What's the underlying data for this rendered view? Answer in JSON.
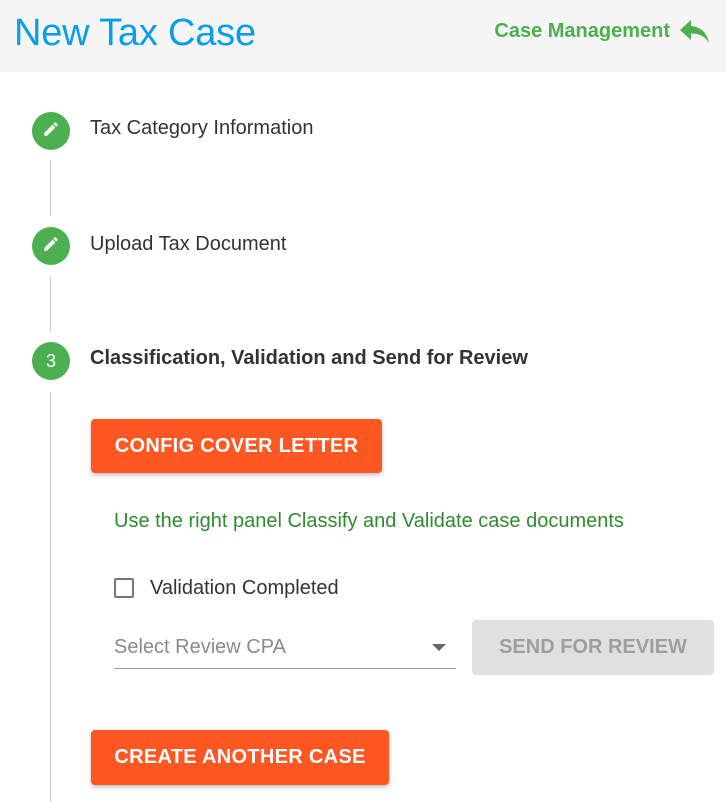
{
  "header": {
    "title": "New Tax Case",
    "nav_link_label": "Case Management",
    "nav_icon": "reply-icon"
  },
  "colors": {
    "title": "#0a9de8",
    "accent_green": "#4caf50",
    "button_orange": "#ff5722",
    "hint_green": "#2e8b2e",
    "disabled_bg": "#e0e0e0"
  },
  "steps": [
    {
      "indicator": "edit-icon",
      "title": "Tax Category Information"
    },
    {
      "indicator": "edit-icon",
      "title": "Upload Tax Document"
    },
    {
      "indicator": "3",
      "title": "Classification, Validation and Send for Review"
    }
  ],
  "step3": {
    "config_button_label": "CONFIG COVER LETTER",
    "hint": "Use the right panel Classify and Validate case documents",
    "checkbox_label": "Validation Completed",
    "checkbox_checked": false,
    "select_placeholder": "Select Review CPA",
    "send_button_label": "SEND FOR REVIEW",
    "send_button_disabled": true,
    "create_button_label": "CREATE ANOTHER CASE"
  }
}
